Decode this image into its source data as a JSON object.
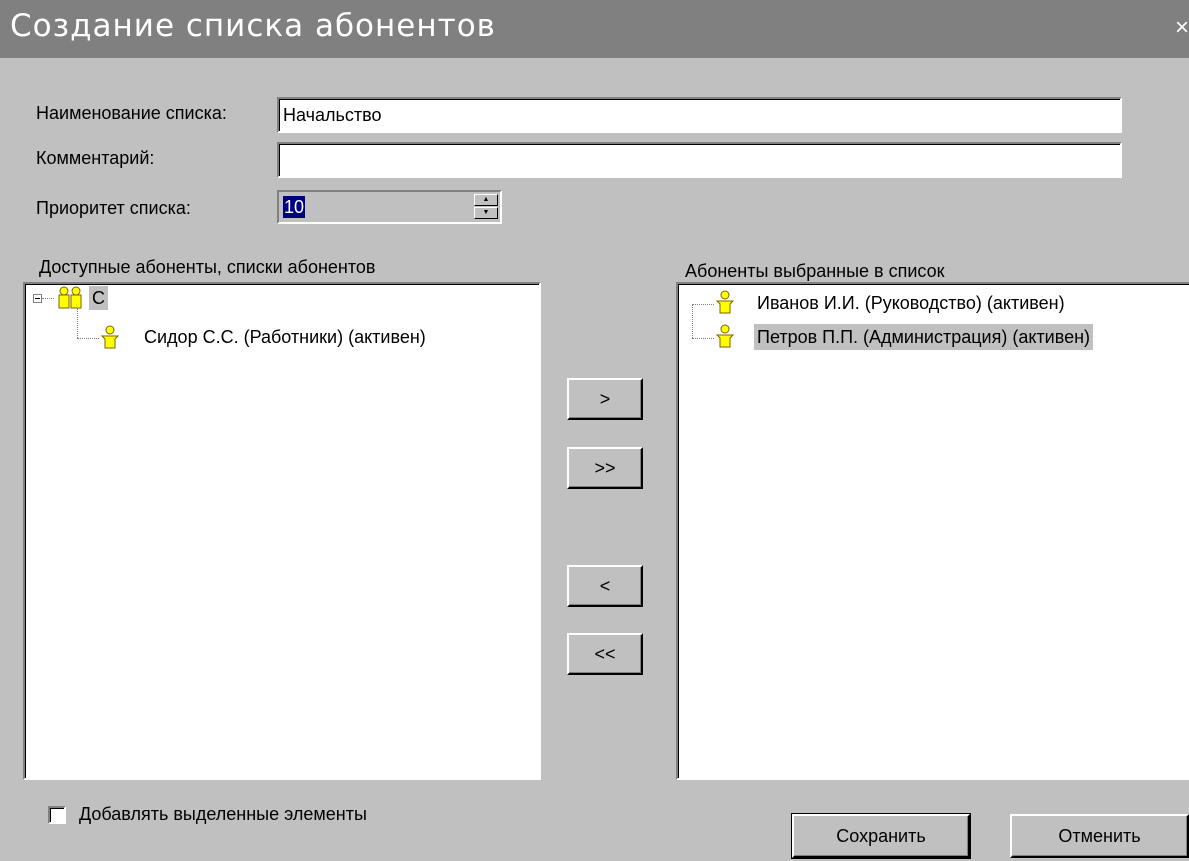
{
  "window": {
    "title": "Создание списка абонентов",
    "close_glyph": "×"
  },
  "form": {
    "name_label": "Наименование списка:",
    "name_value": "Начальство",
    "comment_label": "Комментарий:",
    "comment_value": "",
    "priority_label": "Приоритет списка:",
    "priority_value": "10"
  },
  "available": {
    "label": "Доступные абоненты, списки абонентов",
    "group": {
      "label": "С",
      "icon": "group-icon",
      "expanded": true
    },
    "items": [
      {
        "label": "Сидор С.С. (Работники) (активен)",
        "icon": "person-icon"
      }
    ]
  },
  "selected": {
    "label": "Абоненты выбранные в список",
    "items": [
      {
        "label": "Иванов И.И. (Руководство) (активен)",
        "icon": "person-icon"
      },
      {
        "label": "Петров П.П. (Администрация) (активен)",
        "icon": "person-icon",
        "selected": true
      }
    ]
  },
  "transfer_buttons": {
    "add": ">",
    "add_all": ">>",
    "remove": "<",
    "remove_all": "<<"
  },
  "options": {
    "add_selected_label": "Добавлять выделенные элементы",
    "add_selected_checked": false
  },
  "footer": {
    "save_label": "Сохранить",
    "cancel_label": "Отменить"
  },
  "colors": {
    "face": "#c0c0c0",
    "titlebar": "#808080",
    "selection": "#000080",
    "icon_yellow": "#ffff00"
  }
}
